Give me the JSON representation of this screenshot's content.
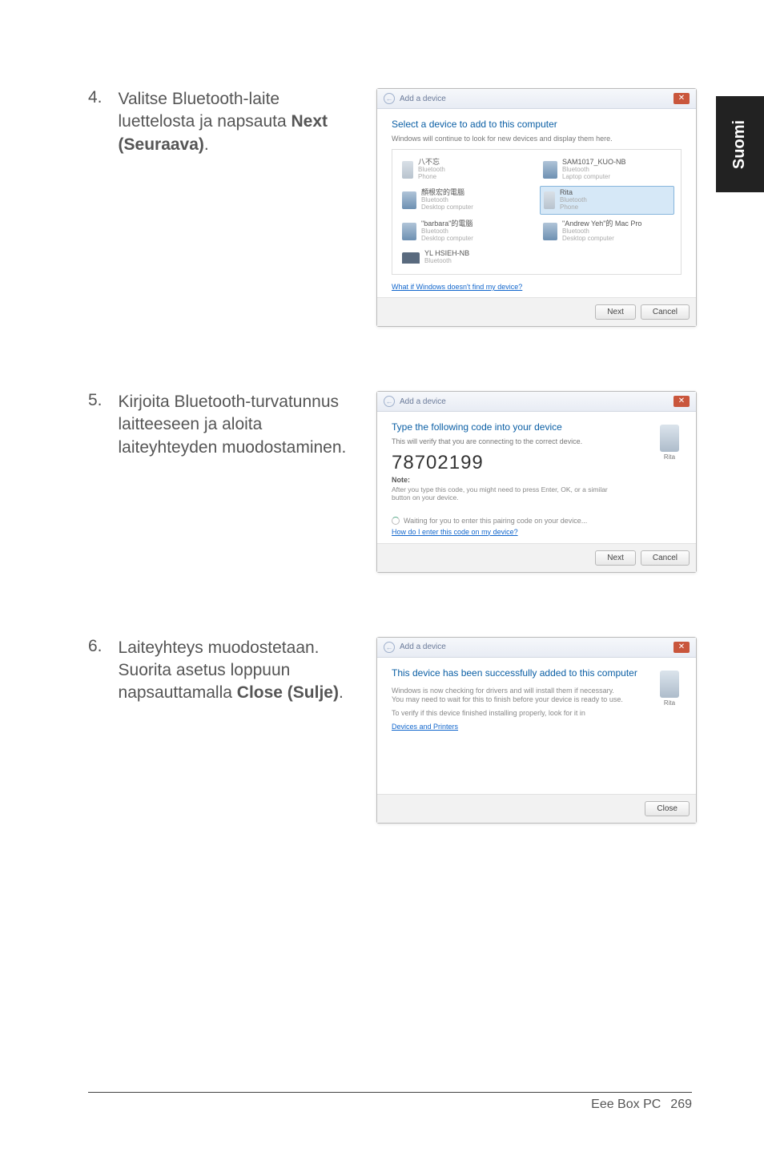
{
  "side_tab": "Suomi",
  "steps": [
    {
      "num": "4.",
      "text_before": "Valitse Bluetooth-laite luettelosta ja napsauta ",
      "bold": "Next (Seuraava)",
      "text_after": "."
    },
    {
      "num": "5.",
      "text_before": "Kirjoita Bluetooth-turvatunnus laitteeseen ja aloita laiteyhteyden muodostaminen.",
      "bold": "",
      "text_after": ""
    },
    {
      "num": "6.",
      "text_before": "Laiteyhteys muodostetaan. Suorita asetus loppuun napsauttamalla ",
      "bold": "Close (Sulje)",
      "text_after": "."
    }
  ],
  "dialog1": {
    "back_glyph": "←",
    "title": "Add a device",
    "close_glyph": "✕",
    "heading": "Select a device to add to this computer",
    "sub": "Windows will continue to look for new devices and display them here.",
    "devices": [
      {
        "name": "八不忘",
        "sub1": "Bluetooth",
        "sub2": "Phone",
        "type": "phone"
      },
      {
        "name": "SAM1017_KUO-NB",
        "sub1": "Bluetooth",
        "sub2": "Laptop computer",
        "type": "comp"
      },
      {
        "name": "顏根宏的電腦",
        "sub1": "Bluetooth",
        "sub2": "Desktop computer",
        "type": "comp"
      },
      {
        "name": "Rita",
        "sub1": "Bluetooth",
        "sub2": "Phone",
        "type": "phone",
        "selected": true
      },
      {
        "name": "\"barbara\"的電腦",
        "sub1": "Bluetooth",
        "sub2": "Desktop computer",
        "type": "comp"
      },
      {
        "name": "\"Andrew Yeh\"的 Mac Pro",
        "sub1": "Bluetooth",
        "sub2": "Desktop computer",
        "type": "comp"
      },
      {
        "name": "YL HSIEH-NB",
        "sub1": "Bluetooth",
        "sub2": "",
        "type": "laptop"
      }
    ],
    "link": "What if Windows doesn't find my device?",
    "btn_next": "Next",
    "btn_cancel": "Cancel"
  },
  "dialog2": {
    "back_glyph": "←",
    "title": "Add a device",
    "close_glyph": "✕",
    "heading": "Type the following code into your device",
    "sub": "This will verify that you are connecting to the correct device.",
    "code": "78702199",
    "note_label": "Note:",
    "note_text": "After you type this code, you might need to press Enter, OK, or a similar button on your device.",
    "icon_label": "Rita",
    "waiting": "Waiting for you to enter this pairing code on your device...",
    "link": "How do I enter this code on my device?",
    "btn_next": "Next",
    "btn_cancel": "Cancel"
  },
  "dialog3": {
    "back_glyph": "←",
    "title": "Add a device",
    "close_glyph": "✕",
    "heading": "This device has been successfully added to this computer",
    "p1": "Windows is now checking for drivers and will install them if necessary. You may need to wait for this to finish before your device is ready to use.",
    "p2": "To verify if this device finished installing properly, look for it in ",
    "link": "Devices and Printers",
    "icon_label": "Rita",
    "btn_close": "Close"
  },
  "footer": {
    "product": "Eee Box PC",
    "page": "269"
  }
}
